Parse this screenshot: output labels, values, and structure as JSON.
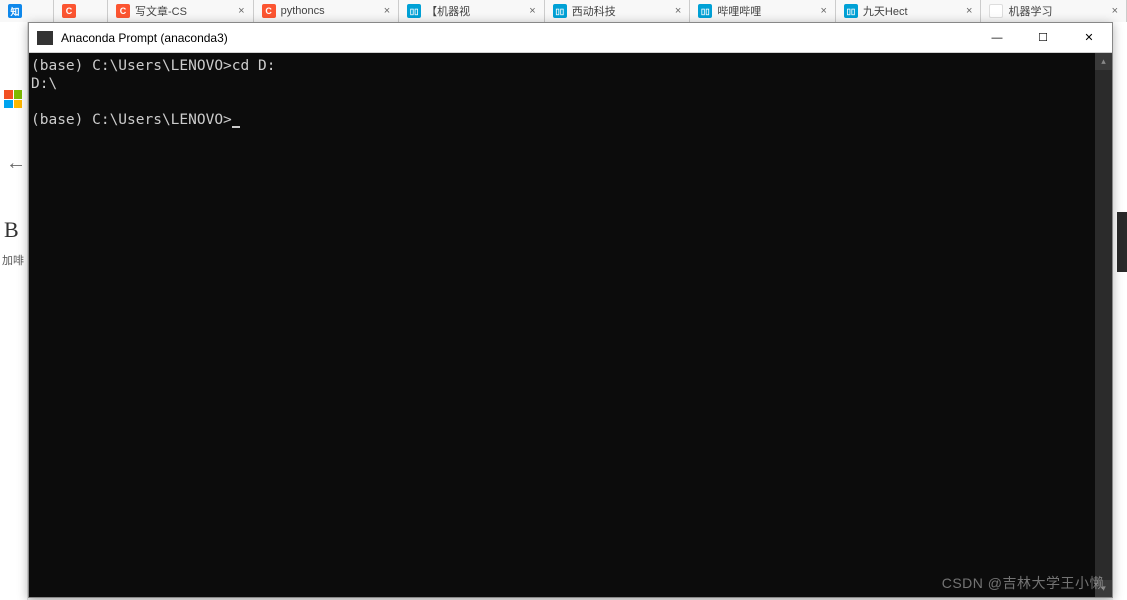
{
  "browser_tabs": [
    {
      "label": "",
      "favicon": "zhihu",
      "favicon_text": "知"
    },
    {
      "label": "",
      "favicon": "csdn",
      "favicon_text": "C"
    },
    {
      "label": "写文章-CS",
      "favicon": "csdn",
      "favicon_text": "C"
    },
    {
      "label": "pythoncs",
      "favicon": "csdn",
      "favicon_text": "C"
    },
    {
      "label": "【机器视",
      "favicon": "bili",
      "favicon_text": "▯▯"
    },
    {
      "label": "西动科技",
      "favicon": "bili",
      "favicon_text": "▯▯"
    },
    {
      "label": "哔哩哔哩",
      "favicon": "bili",
      "favicon_text": "▯▯"
    },
    {
      "label": "九天Hect",
      "favicon": "bili",
      "favicon_text": "▯▯"
    },
    {
      "label": "机器学习",
      "favicon": "blank",
      "favicon_text": ""
    }
  ],
  "tab_close_glyph": "×",
  "left_strip": {
    "back_glyph": "←",
    "big_letter": "B",
    "small_text": "加啡"
  },
  "terminal": {
    "title": "Anaconda Prompt (anaconda3)",
    "line1": "(base) C:\\Users\\LENOVO>cd D:",
    "line2": "D:\\",
    "line3_prefix": "(base) C:\\Users\\LENOVO>",
    "scroll_up_glyph": "▴",
    "scroll_down_glyph": "▾"
  },
  "window_controls": {
    "minimize": "—",
    "maximize": "☐",
    "close": "✕"
  },
  "watermark": "CSDN @吉林大学王小懒"
}
